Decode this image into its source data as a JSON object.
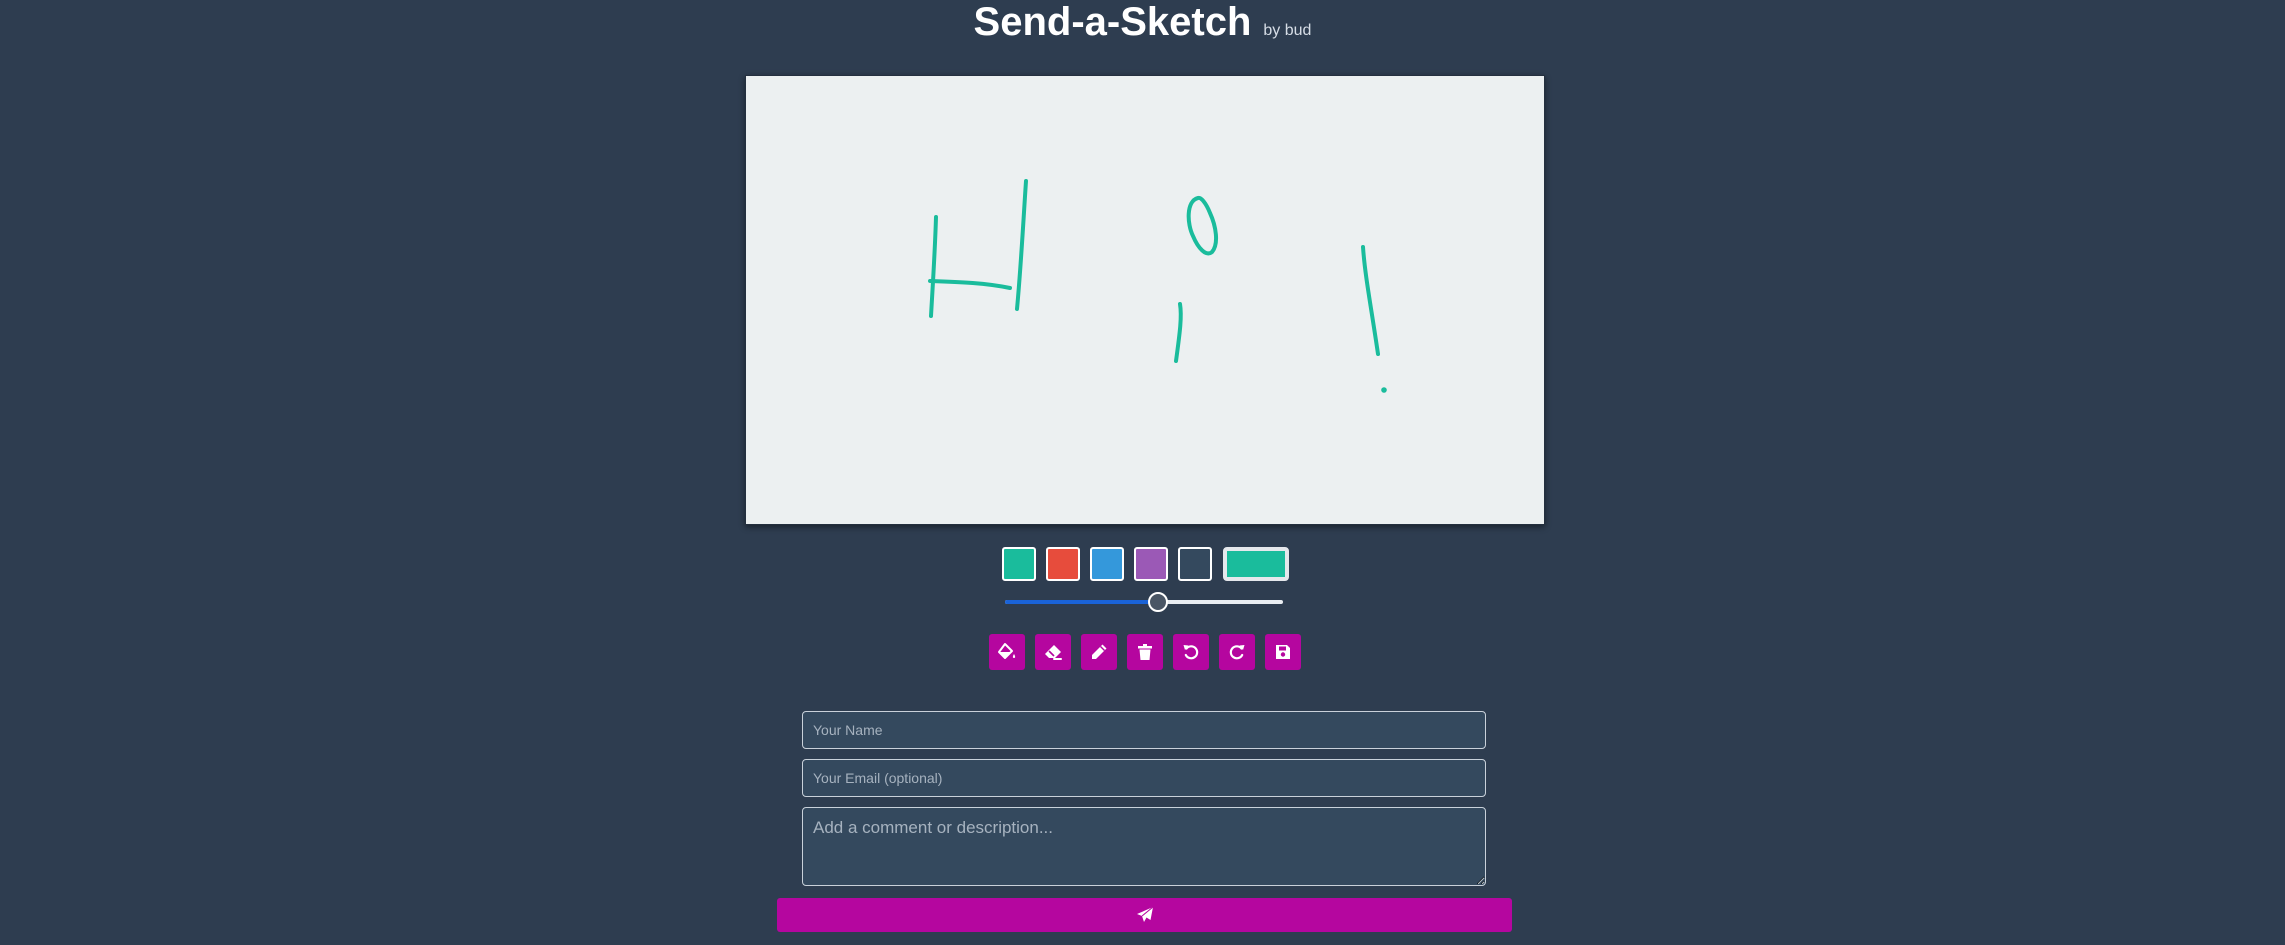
{
  "header": {
    "title": "Send-a-Sketch",
    "byline": "by bud"
  },
  "palette": {
    "swatches": [
      {
        "name": "teal",
        "color": "#1abc9c"
      },
      {
        "name": "red",
        "color": "#e74c3c"
      },
      {
        "name": "blue",
        "color": "#3498db"
      },
      {
        "name": "purple",
        "color": "#9b59b6"
      },
      {
        "name": "dark",
        "color": "#34495e"
      }
    ],
    "current_color": "#1abc9c"
  },
  "brush_size": {
    "value": 0.55
  },
  "toolbar": {
    "buttons": [
      {
        "name": "fill-button",
        "icon": "paint-bucket-icon"
      },
      {
        "name": "eraser-button",
        "icon": "eraser-icon"
      },
      {
        "name": "pencil-button",
        "icon": "pencil-icon"
      },
      {
        "name": "clear-button",
        "icon": "trash-icon"
      },
      {
        "name": "undo-button",
        "icon": "undo-icon"
      },
      {
        "name": "redo-button",
        "icon": "redo-icon"
      },
      {
        "name": "save-button",
        "icon": "floppy-disk-icon"
      }
    ]
  },
  "form": {
    "name_placeholder": "Your Name",
    "name_value": "",
    "email_placeholder": "Your Email (optional)",
    "email_value": "",
    "comment_placeholder": "Add a comment or description...",
    "comment_value": "",
    "send_icon": "paper-plane-icon"
  },
  "theme": {
    "background": "#2e3d50",
    "accent": "#b5069f",
    "canvas": "#ecf0f1",
    "stroke": "#1abc9c"
  }
}
